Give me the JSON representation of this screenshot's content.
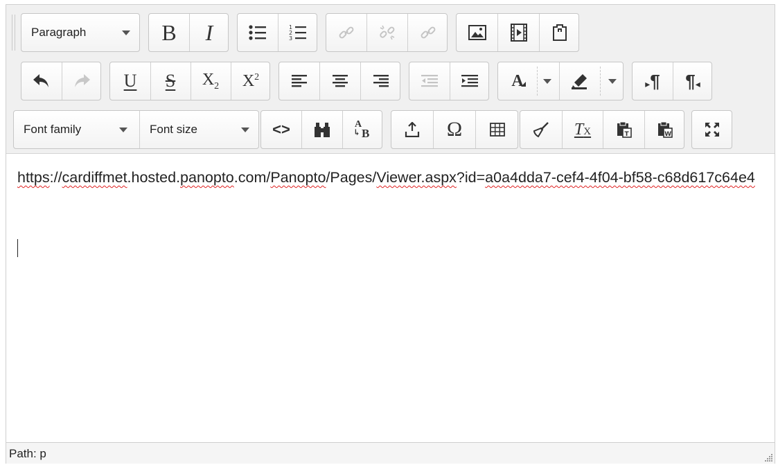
{
  "toolbar": {
    "block_format": "Paragraph",
    "bold_glyph": "B",
    "italic_glyph": "I",
    "underline_glyph": "U",
    "strike_glyph": "S",
    "subscript_glyph": "X",
    "subscript_sub": "2",
    "superscript_glyph": "X",
    "superscript_sup": "2",
    "font_color_glyph": "A",
    "ltr_glyph": "¶",
    "rtl_glyph": "¶",
    "font_family": "Font family",
    "font_size": "Font size",
    "code_glyph": "<>",
    "case_glyph_top": "A",
    "case_glyph_bottom": "B",
    "omega_glyph": "Ω",
    "clear_format_glyph": "T",
    "clear_format_sub": "X"
  },
  "content": {
    "paragraph_parts": [
      "https",
      "://",
      "cardiffmet",
      ".hosted.",
      "panopto",
      ".com/",
      "Panopto",
      "/Pages/",
      "Viewer.aspx",
      "?id=",
      "a0a4dda7-cef4-4f04-bf58-c68d617c64e4"
    ]
  },
  "statusbar": {
    "path": "Path: p"
  }
}
